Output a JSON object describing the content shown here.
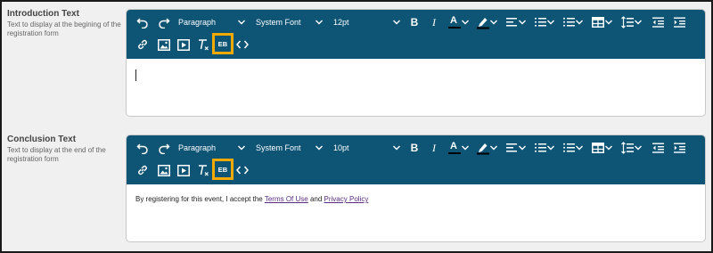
{
  "sections": [
    {
      "title": "Introduction Text",
      "description": "Text to display at the begining of the registration form",
      "toolbar": {
        "block_format": "Paragraph",
        "font_family": "System Font",
        "font_size": "12pt",
        "bold": "B",
        "italic": "I",
        "text_color": "A",
        "eb_label": "EB"
      },
      "content": {
        "text_before": "",
        "link1": "",
        "text_mid": "",
        "link2": ""
      }
    },
    {
      "title": "Conclusion Text",
      "description": "Text to display at the end of the registration form",
      "toolbar": {
        "block_format": "Paragraph",
        "font_family": "System Font",
        "font_size": "10pt",
        "bold": "B",
        "italic": "I",
        "text_color": "A",
        "eb_label": "EB"
      },
      "content": {
        "text_before": "By registering for this event, I accept the ",
        "link1": "Terms Of Use",
        "text_mid": " and ",
        "link2": "Privacy Policy"
      }
    }
  ],
  "colors": {
    "toolbar_bg": "#0e5475",
    "highlight": "#f2a900",
    "link": "#5a2d82"
  },
  "icons": [
    "undo-icon",
    "redo-icon",
    "chevron-down-icon",
    "bold-icon",
    "italic-icon",
    "text-color-icon",
    "highlight-icon",
    "align-icon",
    "numbered-list-icon",
    "bullet-list-icon",
    "table-icon",
    "line-height-icon",
    "outdent-icon",
    "indent-icon",
    "link-icon",
    "image-icon",
    "media-icon",
    "clear-format-icon",
    "source-code-icon"
  ]
}
